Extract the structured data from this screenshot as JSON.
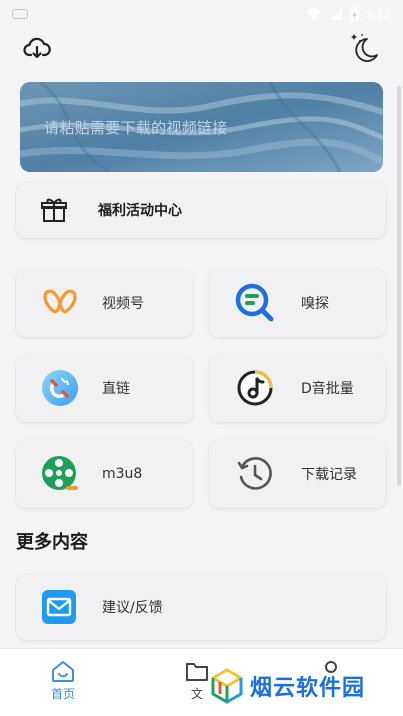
{
  "status_bar": {
    "time": "3:12"
  },
  "search": {
    "placeholder": "请粘贴需要下载的视频链接"
  },
  "activity": {
    "label": "福利活动中心"
  },
  "tiles": [
    {
      "label": "视频号",
      "icon": "butterfly-icon"
    },
    {
      "label": "嗅探",
      "icon": "sniff-search-icon"
    },
    {
      "label": "直链",
      "icon": "link-magnet-icon"
    },
    {
      "label": "D音批量",
      "icon": "tiktok-music-icon"
    },
    {
      "label": "m3u8",
      "icon": "film-reel-icon"
    },
    {
      "label": "下载记录",
      "icon": "history-clock-icon"
    }
  ],
  "more_section": {
    "title": "更多内容"
  },
  "feedback": {
    "label": "建议/反馈"
  },
  "bottom_nav": {
    "home": "首页",
    "files": "文"
  },
  "watermark": {
    "text": "烟云软件园"
  },
  "colors": {
    "accent": "#3a8ef0",
    "background": "#f4f4f6",
    "card": "#f1f1f3",
    "orange": "#f49a30",
    "blue": "#1f6fe0",
    "green": "#1ea05a",
    "yellow": "#f2c230"
  }
}
